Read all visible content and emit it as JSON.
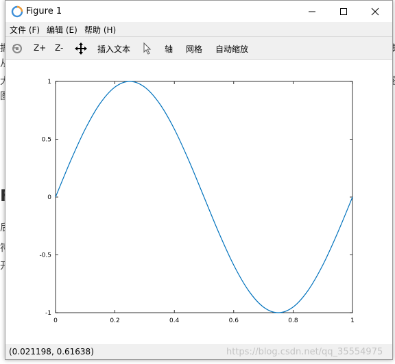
{
  "window": {
    "title": "Figure 1"
  },
  "menu": {
    "items": [
      {
        "label": "文件 (F)"
      },
      {
        "label": "编辑 (E)"
      },
      {
        "label": "帮助 (H)"
      }
    ]
  },
  "toolbar": {
    "zoom_in_label": "Z+",
    "zoom_out_label": "Z-",
    "insert_text_label": "插入文本",
    "axes_label": "轴",
    "grid_label": "网格",
    "autoscale_label": "自动缩放"
  },
  "status": {
    "coordinates": "(0.021198, 0.61638)"
  },
  "watermark": {
    "text": "https://blog.csdn.net/qq_35554975"
  },
  "colors": {
    "line": "#0072bd",
    "axes": "#000000",
    "chrome": "#f0f0f0"
  },
  "chart_data": {
    "type": "line",
    "title": "",
    "xlabel": "",
    "ylabel": "",
    "xlim": [
      0,
      1
    ],
    "ylim": [
      -1,
      1
    ],
    "xticks": [
      "0",
      "0.2",
      "0.4",
      "0.6",
      "0.8",
      "1"
    ],
    "yticks": [
      "-1",
      "-0.5",
      "0",
      "0.5",
      "1"
    ],
    "grid": false,
    "series": [
      {
        "x": [
          0,
          0.05,
          0.1,
          0.15,
          0.2,
          0.25,
          0.3,
          0.35,
          0.4,
          0.45,
          0.5,
          0.55,
          0.6,
          0.65,
          0.7,
          0.75,
          0.8,
          0.85,
          0.9,
          0.95,
          1.0
        ],
        "y": [
          0,
          0.309,
          0.588,
          0.809,
          0.951,
          1.0,
          0.951,
          0.809,
          0.588,
          0.309,
          0,
          -0.309,
          -0.588,
          -0.809,
          -0.951,
          -1.0,
          -0.951,
          -0.809,
          -0.588,
          -0.309,
          0
        ]
      }
    ]
  }
}
